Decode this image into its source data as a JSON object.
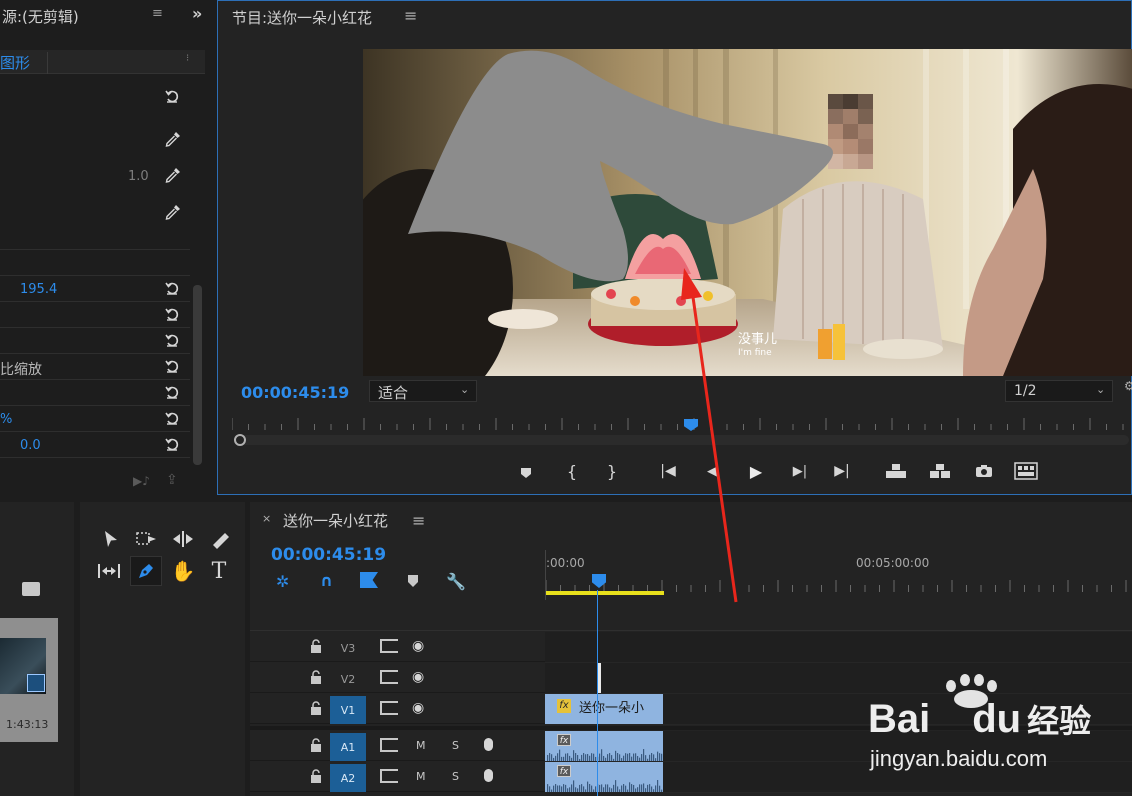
{
  "source_panel": {
    "title": "源:(无剪辑)",
    "tab_label": "图形",
    "props": [
      {
        "value": "",
        "blue": false
      },
      {
        "value": "",
        "blue": false
      },
      {
        "value": "1.0",
        "blue": false
      },
      {
        "value": "",
        "blue": false
      },
      {
        "value": "195.4",
        "blue": true
      },
      {
        "value": "",
        "blue": false
      },
      {
        "value": "",
        "blue": false
      },
      {
        "value": "比缩放",
        "blue": false
      },
      {
        "value": "",
        "blue": false
      },
      {
        "value": "%",
        "blue": true
      },
      {
        "value": "0.0",
        "blue": true
      }
    ]
  },
  "program_monitor": {
    "title": "节目:送你一朵小红花",
    "timecode": "00:00:45:19",
    "fit_select": "适合",
    "resolution_select": "1/2",
    "subtitle_line1": "没事儿",
    "subtitle_line2": "I'm fine",
    "playhead_fraction": 0.51
  },
  "project_panel": {
    "thumb_duration": "1:43:13"
  },
  "timeline": {
    "title": "送你一朵小红花",
    "timecode": "00:00:45:19",
    "ruler_labels": [
      ":00:00",
      "00:05:00:00"
    ],
    "video_tracks": [
      {
        "name": "V3",
        "target": false
      },
      {
        "name": "V2",
        "target": false
      },
      {
        "name": "V1",
        "target": true
      }
    ],
    "audio_tracks": [
      {
        "name": "A1",
        "m": "M",
        "s": "S"
      },
      {
        "name": "A2",
        "m": "M",
        "s": "S"
      }
    ],
    "clip_label": "送你一朵小",
    "fx_label": "fx"
  },
  "watermark": {
    "brand": "Bai",
    "brand2": "du",
    "cn": "经验",
    "url": "jingyan.baidu.com"
  },
  "colors": {
    "accent_blue": "#2d8ceb",
    "clip_blue": "#8fb4e0",
    "target_blue": "#1c5f97",
    "arrow_red": "#e8261c",
    "work_area_yellow": "#e8e01c"
  }
}
